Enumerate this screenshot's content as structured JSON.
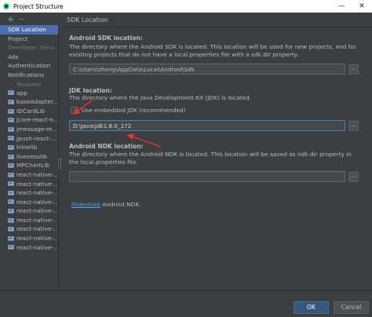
{
  "window": {
    "title": "Project Structure",
    "minimize_glyph": "—",
    "close_glyph": "✕"
  },
  "sidebar": {
    "add_glyph": "+",
    "remove_glyph": "−",
    "items": [
      {
        "label": "SDK Location",
        "selected": true
      },
      {
        "label": "Project",
        "selected": false
      }
    ],
    "section_label": "Developer Servi...",
    "services": [
      "Ads",
      "Authentication",
      "Notifications"
    ],
    "modules_header": "Modules",
    "modules": [
      "app",
      "baseAdapter...",
      "IDCardLib",
      "jcore-react-n...",
      "jmessage-re...",
      "jpush-react-...",
      "klinelib",
      "livenesslib",
      "MPChartLib",
      "react-native-...",
      "react-native-...",
      "react-native-...",
      "react-native-...",
      "react-native-...",
      "react-native-...",
      "react-native-...",
      "react-native-...",
      "react-native-..."
    ]
  },
  "panel": {
    "title": "SDK Location",
    "android_sdk": {
      "label": "Android SDK location:",
      "description": "The directory where the Android SDK is located. This location will be used for new projects, and for existing projects that do not have a local.properties file with a sdk.dir property.",
      "value": "C:\\Users\\zheng\\AppData\\Local\\Android\\Sdk",
      "browse_label": "..."
    },
    "jdk": {
      "label": "JDK location:",
      "description": "The directory where the Java Development Kit (JDK) is located.",
      "embedded_checkbox_label": "Use embedded JDK (recommended)",
      "embedded_checked": false,
      "value": "D:\\Java\\jdk1.8.0_172",
      "browse_label": "..."
    },
    "ndk": {
      "label": "Android NDK location:",
      "description": "The directory where the Android NDK is located. This location will be saved as ndk.dir property in the local.properties file.",
      "value": "",
      "browse_label": "...",
      "download_link": "Download",
      "download_suffix": " Android NDK."
    }
  },
  "footer": {
    "ok_label": "OK",
    "cancel_label": "Cancel"
  },
  "colors": {
    "background": "#3c3f41",
    "selection": "#4b6eaf",
    "focus_border": "#3d7fbf",
    "link": "#589df6",
    "annotation_arrow": "#e8352b"
  }
}
